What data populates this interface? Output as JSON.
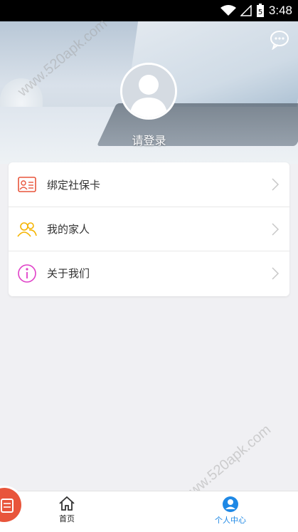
{
  "status_bar": {
    "time": "3:48",
    "battery_level": "5"
  },
  "header": {
    "login_label": "请登录"
  },
  "menu": {
    "items": [
      {
        "label": "绑定社保卡",
        "icon": "id-card-icon",
        "color": "#e8553b"
      },
      {
        "label": "我的家人",
        "icon": "family-icon",
        "color": "#f5b400"
      },
      {
        "label": "关于我们",
        "icon": "info-icon",
        "color": "#e040c8"
      }
    ]
  },
  "bottom_nav": {
    "tabs": [
      {
        "label": "首页",
        "icon": "home-icon",
        "active": false
      },
      {
        "label": "个人中心",
        "icon": "user-icon",
        "active": true
      }
    ],
    "active_color": "#1e88e5"
  },
  "watermark": {
    "text": "www.520apk.com"
  }
}
